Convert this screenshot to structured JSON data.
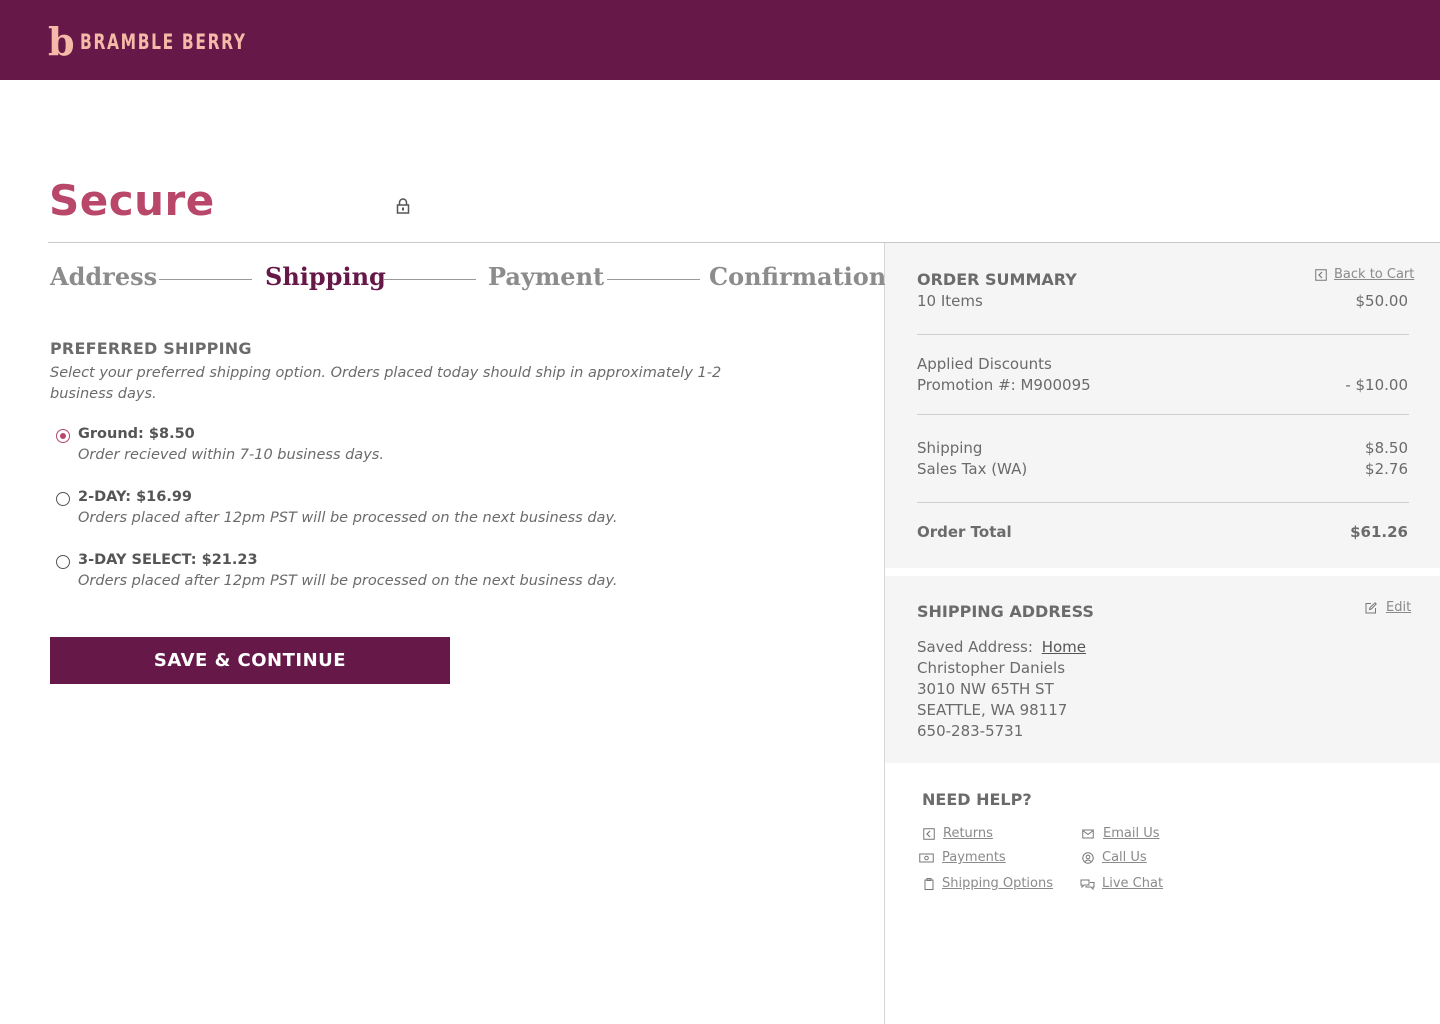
{
  "header": {
    "logo_mark": "b",
    "logo_text": "BRAMBLE BERRY"
  },
  "page_title": "Secure",
  "steps": [
    {
      "label": "Address",
      "state": "inactive"
    },
    {
      "label": "Shipping",
      "state": "active"
    },
    {
      "label": "Payment",
      "state": "inactive"
    },
    {
      "label": "Confirmation",
      "state": "inactive"
    }
  ],
  "shipping": {
    "heading": "PREFERRED SHIPPING",
    "description": "Select your preferred shipping option.  Orders placed today should ship in approximately 1-2 business days.",
    "options": [
      {
        "title": "Ground: $8.50",
        "subtitle": "Order recieved within 7-10 business days.",
        "selected": true
      },
      {
        "title": "2-DAY: $16.99",
        "subtitle": "Orders placed after 12pm PST will be processed on the next business day.",
        "selected": false
      },
      {
        "title": "3-DAY SELECT: $21.23",
        "subtitle": "Orders placed after 12pm PST will be processed on the next business day.",
        "selected": false
      }
    ],
    "save_label": "SAVE & CONTINUE"
  },
  "summary": {
    "heading": "ORDER SUMMARY",
    "back_to_cart": "Back to Cart",
    "items_label": "10 Items",
    "items_value": "$50.00",
    "discounts_label": "Applied Discounts",
    "promo_label": "Promotion #: M900095",
    "promo_value": "- $10.00",
    "shipping_label": "Shipping",
    "shipping_value": "$8.50",
    "tax_label": "Sales Tax (WA)",
    "tax_value": "$2.76",
    "total_label": "Order Total",
    "total_value": "$61.26"
  },
  "address": {
    "heading": "SHIPPING ADDRESS",
    "edit_label": "Edit",
    "saved_label": "Saved Address:",
    "saved_name": "Home",
    "name": "Christopher Daniels",
    "street": "3010 NW 65TH ST",
    "city": "SEATTLE, WA 98117",
    "phone": "650-283-5731"
  },
  "help": {
    "heading": "NEED HELP?",
    "links": {
      "returns": "Returns",
      "payments": "Payments",
      "shipping_options": "Shipping Options",
      "email": "Email Us",
      "call": "Call Us",
      "chat": "Live Chat"
    }
  },
  "colors": {
    "brand": "#661848",
    "accent": "#b8476a",
    "logo": "#f5b9a8",
    "panel": "#f5f5f5"
  }
}
